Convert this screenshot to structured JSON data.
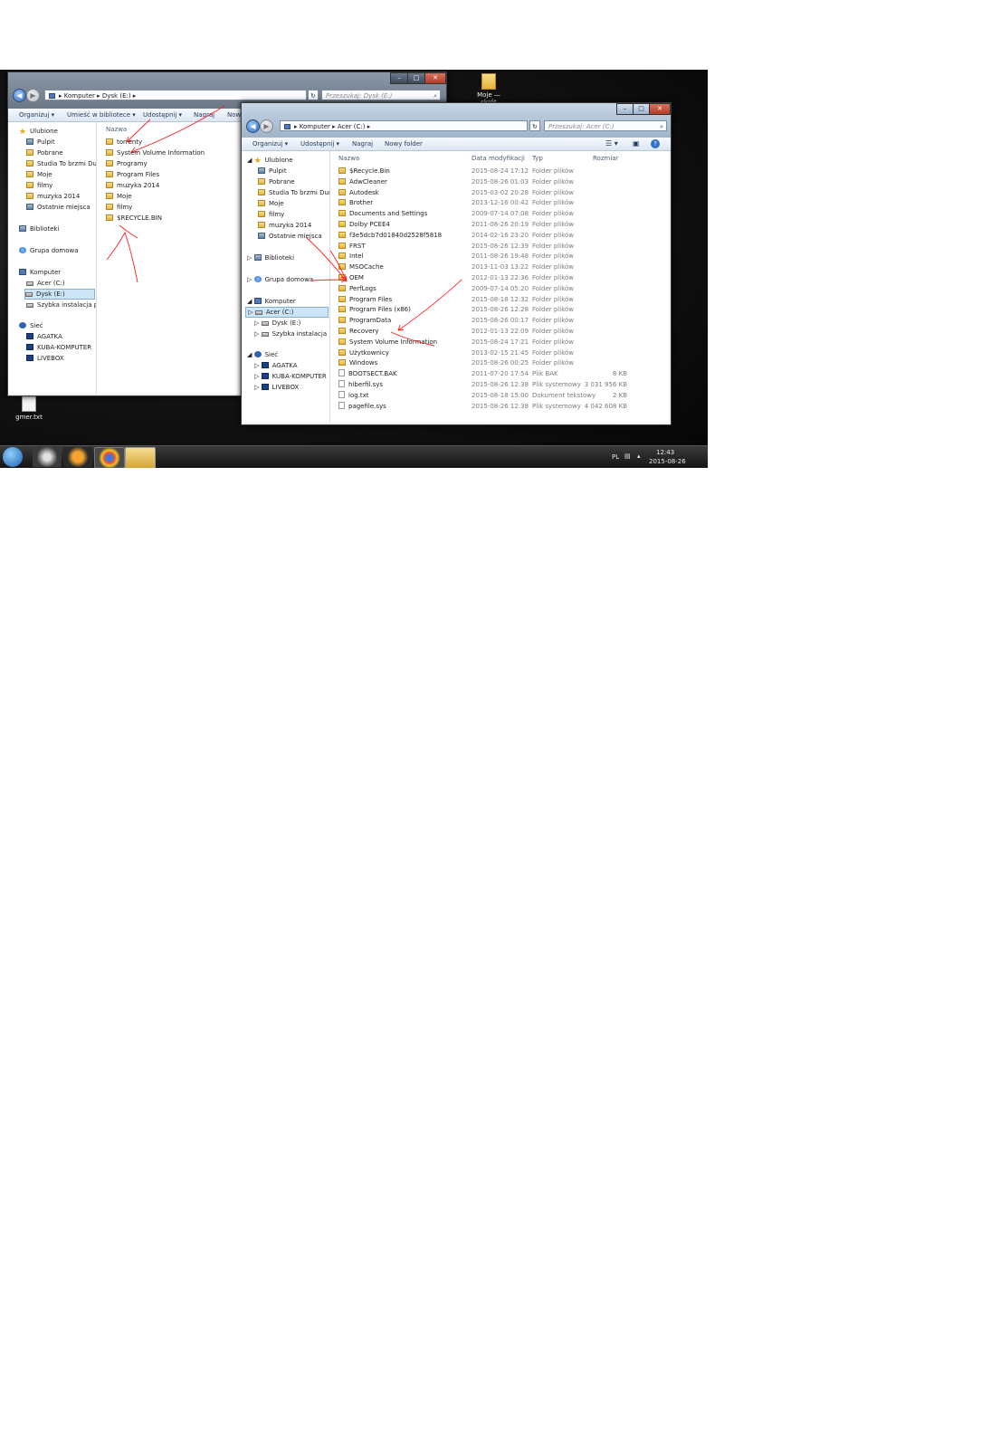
{
  "desktop": {
    "shortcut_top": "Moje — skrót",
    "shortcut_file": "gmer.txt"
  },
  "win_e": {
    "address": [
      "Komputer",
      "Dysk (E:)"
    ],
    "search_placeholder": "Przeszukaj: Dysk (E:)",
    "toolbar": [
      "Organizuj ▾",
      "Umieść w bibliotece ▾",
      "Udostępnij ▾",
      "Nagraj",
      "Nowy folder"
    ],
    "nav": {
      "favorites_label": "Ulubione",
      "favorites": [
        "Pulpit",
        "Pobrane",
        "Studia To brzmi Dumnie",
        "Moje",
        "filmy",
        "muzyka 2014",
        "Ostatnie miejsca"
      ],
      "libraries": "Biblioteki",
      "homegroup": "Grupa domowa",
      "computer": "Komputer",
      "drives": [
        "Acer (C:)",
        "Dysk (E:)",
        "Szybka instalacja pakietu"
      ],
      "network": "Sieć",
      "network_items": [
        "AGATKA",
        "KUBA-KOMPUTER",
        "LIVEBOX"
      ]
    },
    "column_name": "Nazwa",
    "files": [
      "torrenty",
      "System Volume Information",
      "Programy",
      "Program Files",
      "muzyka 2014",
      "Moje",
      "filmy",
      "$RECYCLE.BIN"
    ]
  },
  "win_c": {
    "address": [
      "Komputer",
      "Acer (C:)"
    ],
    "search_placeholder": "Przeszukaj: Acer (C:)",
    "toolbar": [
      "Organizuj ▾",
      "Udostępnij ▾",
      "Nagraj",
      "Nowy folder"
    ],
    "nav": {
      "favorites_label": "Ulubione",
      "favorites": [
        "Pulpit",
        "Pobrane",
        "Studia To brzmi Dumnie",
        "Moje",
        "filmy",
        "muzyka 2014",
        "Ostatnie miejsca"
      ],
      "libraries": "Biblioteki",
      "homegroup": "Grupa domowa",
      "computer": "Komputer",
      "drives": [
        "Acer (C:)",
        "Dysk (E:)",
        "Szybka instalacja pakietu"
      ],
      "network": "Sieć",
      "network_items": [
        "AGATKA",
        "KUBA-KOMPUTER",
        "LIVEBOX"
      ]
    },
    "columns": [
      "Nazwa",
      "Data modyfikacji",
      "Typ",
      "Rozmiar"
    ],
    "rows": [
      {
        "name": "$Recycle.Bin",
        "date": "2015-08-24 17:12",
        "type": "Folder plików",
        "size": ""
      },
      {
        "name": "AdwCleaner",
        "date": "2015-08-26 01:03",
        "type": "Folder plików",
        "size": ""
      },
      {
        "name": "Autodesk",
        "date": "2015-03-02 20:28",
        "type": "Folder plików",
        "size": ""
      },
      {
        "name": "Brother",
        "date": "2013-12-16 00:42",
        "type": "Folder plików",
        "size": ""
      },
      {
        "name": "Documents and Settings",
        "date": "2009-07-14 07:08",
        "type": "Folder plików",
        "size": ""
      },
      {
        "name": "Dolby PCEE4",
        "date": "2011-08-26 20:19",
        "type": "Folder plików",
        "size": ""
      },
      {
        "name": "f3e5dcb7d01840d2528f5818",
        "date": "2014-02-16 23:20",
        "type": "Folder plików",
        "size": ""
      },
      {
        "name": "FRST",
        "date": "2015-08-26 12:39",
        "type": "Folder plików",
        "size": ""
      },
      {
        "name": "Intel",
        "date": "2011-08-26 19:48",
        "type": "Folder plików",
        "size": ""
      },
      {
        "name": "MSOCache",
        "date": "2013-11-03 13:22",
        "type": "Folder plików",
        "size": ""
      },
      {
        "name": "OEM",
        "date": "2012-01-13 22:36",
        "type": "Folder plików",
        "size": ""
      },
      {
        "name": "PerfLogs",
        "date": "2009-07-14 05:20",
        "type": "Folder plików",
        "size": ""
      },
      {
        "name": "Program Files",
        "date": "2015-08-18 12:32",
        "type": "Folder plików",
        "size": ""
      },
      {
        "name": "Program Files (x86)",
        "date": "2015-08-26 12:28",
        "type": "Folder plików",
        "size": ""
      },
      {
        "name": "ProgramData",
        "date": "2015-08-26 00:17",
        "type": "Folder plików",
        "size": ""
      },
      {
        "name": "Recovery",
        "date": "2012-01-13 22:09",
        "type": "Folder plików",
        "size": ""
      },
      {
        "name": "System Volume Information",
        "date": "2015-08-24 17:21",
        "type": "Folder plików",
        "size": ""
      },
      {
        "name": "Użytkownicy",
        "date": "2013-02-15 21:45",
        "type": "Folder plików",
        "size": ""
      },
      {
        "name": "Windows",
        "date": "2015-08-26 00:25",
        "type": "Folder plików",
        "size": ""
      },
      {
        "name": "BOOTSECT.BAK",
        "date": "2011-07-20 17:54",
        "type": "Plik BAK",
        "size": "8 KB"
      },
      {
        "name": "hiberfil.sys",
        "date": "2015-08-26 12:38",
        "type": "Plik systemowy",
        "size": "3 031 956 KB"
      },
      {
        "name": "log.txt",
        "date": "2015-08-18 15:00",
        "type": "Dokument tekstowy",
        "size": "2 KB"
      },
      {
        "name": "pagefile.sys",
        "date": "2015-08-26 12:38",
        "type": "Plik systemowy",
        "size": "4 042 608 KB"
      }
    ]
  },
  "taskbar": {
    "lang": "PL",
    "time": "12:43",
    "date": "2015-08-26"
  },
  "colors": {
    "annotation": "#ff2020",
    "selection": "#cde6f7",
    "folder": "#e4b33b"
  }
}
